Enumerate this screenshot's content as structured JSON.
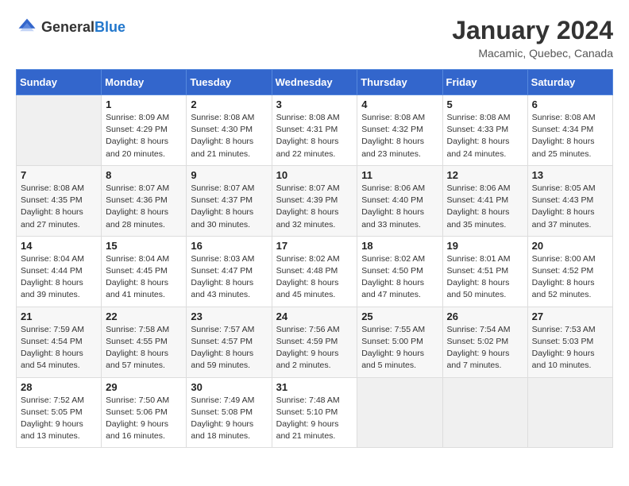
{
  "header": {
    "logo_general": "General",
    "logo_blue": "Blue",
    "month": "January 2024",
    "location": "Macamic, Quebec, Canada"
  },
  "weekdays": [
    "Sunday",
    "Monday",
    "Tuesday",
    "Wednesday",
    "Thursday",
    "Friday",
    "Saturday"
  ],
  "weeks": [
    [
      {
        "day": "",
        "sunrise": "",
        "sunset": "",
        "daylight": ""
      },
      {
        "day": "1",
        "sunrise": "Sunrise: 8:09 AM",
        "sunset": "Sunset: 4:29 PM",
        "daylight": "Daylight: 8 hours and 20 minutes."
      },
      {
        "day": "2",
        "sunrise": "Sunrise: 8:08 AM",
        "sunset": "Sunset: 4:30 PM",
        "daylight": "Daylight: 8 hours and 21 minutes."
      },
      {
        "day": "3",
        "sunrise": "Sunrise: 8:08 AM",
        "sunset": "Sunset: 4:31 PM",
        "daylight": "Daylight: 8 hours and 22 minutes."
      },
      {
        "day": "4",
        "sunrise": "Sunrise: 8:08 AM",
        "sunset": "Sunset: 4:32 PM",
        "daylight": "Daylight: 8 hours and 23 minutes."
      },
      {
        "day": "5",
        "sunrise": "Sunrise: 8:08 AM",
        "sunset": "Sunset: 4:33 PM",
        "daylight": "Daylight: 8 hours and 24 minutes."
      },
      {
        "day": "6",
        "sunrise": "Sunrise: 8:08 AM",
        "sunset": "Sunset: 4:34 PM",
        "daylight": "Daylight: 8 hours and 25 minutes."
      }
    ],
    [
      {
        "day": "7",
        "sunrise": "Sunrise: 8:08 AM",
        "sunset": "Sunset: 4:35 PM",
        "daylight": "Daylight: 8 hours and 27 minutes."
      },
      {
        "day": "8",
        "sunrise": "Sunrise: 8:07 AM",
        "sunset": "Sunset: 4:36 PM",
        "daylight": "Daylight: 8 hours and 28 minutes."
      },
      {
        "day": "9",
        "sunrise": "Sunrise: 8:07 AM",
        "sunset": "Sunset: 4:37 PM",
        "daylight": "Daylight: 8 hours and 30 minutes."
      },
      {
        "day": "10",
        "sunrise": "Sunrise: 8:07 AM",
        "sunset": "Sunset: 4:39 PM",
        "daylight": "Daylight: 8 hours and 32 minutes."
      },
      {
        "day": "11",
        "sunrise": "Sunrise: 8:06 AM",
        "sunset": "Sunset: 4:40 PM",
        "daylight": "Daylight: 8 hours and 33 minutes."
      },
      {
        "day": "12",
        "sunrise": "Sunrise: 8:06 AM",
        "sunset": "Sunset: 4:41 PM",
        "daylight": "Daylight: 8 hours and 35 minutes."
      },
      {
        "day": "13",
        "sunrise": "Sunrise: 8:05 AM",
        "sunset": "Sunset: 4:43 PM",
        "daylight": "Daylight: 8 hours and 37 minutes."
      }
    ],
    [
      {
        "day": "14",
        "sunrise": "Sunrise: 8:04 AM",
        "sunset": "Sunset: 4:44 PM",
        "daylight": "Daylight: 8 hours and 39 minutes."
      },
      {
        "day": "15",
        "sunrise": "Sunrise: 8:04 AM",
        "sunset": "Sunset: 4:45 PM",
        "daylight": "Daylight: 8 hours and 41 minutes."
      },
      {
        "day": "16",
        "sunrise": "Sunrise: 8:03 AM",
        "sunset": "Sunset: 4:47 PM",
        "daylight": "Daylight: 8 hours and 43 minutes."
      },
      {
        "day": "17",
        "sunrise": "Sunrise: 8:02 AM",
        "sunset": "Sunset: 4:48 PM",
        "daylight": "Daylight: 8 hours and 45 minutes."
      },
      {
        "day": "18",
        "sunrise": "Sunrise: 8:02 AM",
        "sunset": "Sunset: 4:50 PM",
        "daylight": "Daylight: 8 hours and 47 minutes."
      },
      {
        "day": "19",
        "sunrise": "Sunrise: 8:01 AM",
        "sunset": "Sunset: 4:51 PM",
        "daylight": "Daylight: 8 hours and 50 minutes."
      },
      {
        "day": "20",
        "sunrise": "Sunrise: 8:00 AM",
        "sunset": "Sunset: 4:52 PM",
        "daylight": "Daylight: 8 hours and 52 minutes."
      }
    ],
    [
      {
        "day": "21",
        "sunrise": "Sunrise: 7:59 AM",
        "sunset": "Sunset: 4:54 PM",
        "daylight": "Daylight: 8 hours and 54 minutes."
      },
      {
        "day": "22",
        "sunrise": "Sunrise: 7:58 AM",
        "sunset": "Sunset: 4:55 PM",
        "daylight": "Daylight: 8 hours and 57 minutes."
      },
      {
        "day": "23",
        "sunrise": "Sunrise: 7:57 AM",
        "sunset": "Sunset: 4:57 PM",
        "daylight": "Daylight: 8 hours and 59 minutes."
      },
      {
        "day": "24",
        "sunrise": "Sunrise: 7:56 AM",
        "sunset": "Sunset: 4:59 PM",
        "daylight": "Daylight: 9 hours and 2 minutes."
      },
      {
        "day": "25",
        "sunrise": "Sunrise: 7:55 AM",
        "sunset": "Sunset: 5:00 PM",
        "daylight": "Daylight: 9 hours and 5 minutes."
      },
      {
        "day": "26",
        "sunrise": "Sunrise: 7:54 AM",
        "sunset": "Sunset: 5:02 PM",
        "daylight": "Daylight: 9 hours and 7 minutes."
      },
      {
        "day": "27",
        "sunrise": "Sunrise: 7:53 AM",
        "sunset": "Sunset: 5:03 PM",
        "daylight": "Daylight: 9 hours and 10 minutes."
      }
    ],
    [
      {
        "day": "28",
        "sunrise": "Sunrise: 7:52 AM",
        "sunset": "Sunset: 5:05 PM",
        "daylight": "Daylight: 9 hours and 13 minutes."
      },
      {
        "day": "29",
        "sunrise": "Sunrise: 7:50 AM",
        "sunset": "Sunset: 5:06 PM",
        "daylight": "Daylight: 9 hours and 16 minutes."
      },
      {
        "day": "30",
        "sunrise": "Sunrise: 7:49 AM",
        "sunset": "Sunset: 5:08 PM",
        "daylight": "Daylight: 9 hours and 18 minutes."
      },
      {
        "day": "31",
        "sunrise": "Sunrise: 7:48 AM",
        "sunset": "Sunset: 5:10 PM",
        "daylight": "Daylight: 9 hours and 21 minutes."
      },
      {
        "day": "",
        "sunrise": "",
        "sunset": "",
        "daylight": ""
      },
      {
        "day": "",
        "sunrise": "",
        "sunset": "",
        "daylight": ""
      },
      {
        "day": "",
        "sunrise": "",
        "sunset": "",
        "daylight": ""
      }
    ]
  ]
}
